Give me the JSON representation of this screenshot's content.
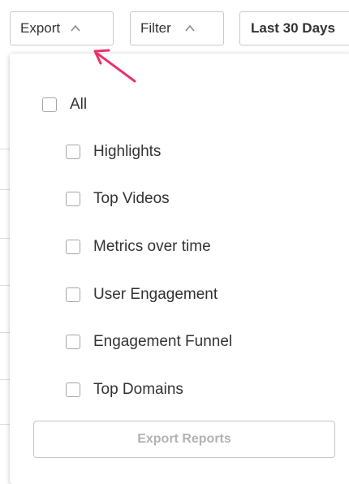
{
  "toolbar": {
    "export_label": "Export",
    "filter_label": "Filter",
    "range_label": "Last 30 Days"
  },
  "export_menu": {
    "all_label": "All",
    "items": [
      {
        "label": "Highlights",
        "checked": false
      },
      {
        "label": "Top Videos",
        "checked": false
      },
      {
        "label": "Metrics over time",
        "checked": false
      },
      {
        "label": "User Engagement",
        "checked": false
      },
      {
        "label": "Engagement Funnel",
        "checked": false
      },
      {
        "label": "Top Domains",
        "checked": false
      }
    ],
    "export_button_label": "Export Reports"
  },
  "colors": {
    "annotation_arrow": "#e8336b",
    "checkbox_border": "#a6a6a6",
    "disabled_text": "#b3b3b3"
  }
}
